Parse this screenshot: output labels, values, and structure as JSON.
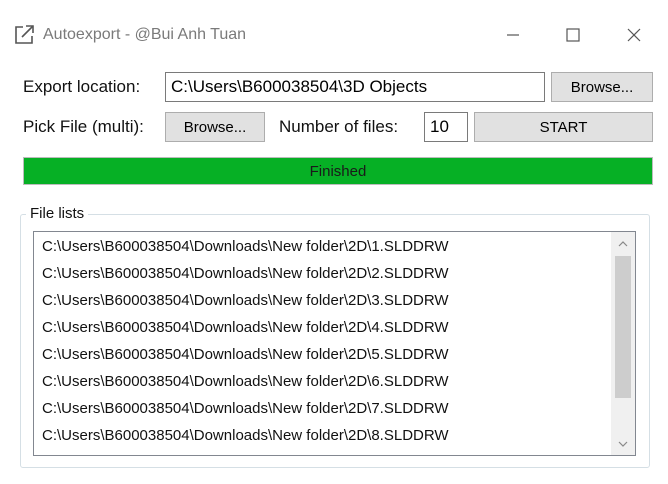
{
  "window": {
    "title": "Autoexport - @Bui Anh Tuan",
    "icons": [
      "export-icon",
      "minimize-icon",
      "maximize-icon",
      "close-icon"
    ]
  },
  "export": {
    "label": "Export location:",
    "path": "C:\\Users\\B600038504\\3D Objects",
    "browse_label": "Browse..."
  },
  "pick": {
    "label": "Pick File (multi):",
    "browse_label": "Browse...",
    "count_label": "Number of files:",
    "count_value": "10",
    "start_label": "START"
  },
  "progress": {
    "text": "Finished",
    "value": 1.0,
    "color": "#06b025"
  },
  "file_list": {
    "title": "File lists",
    "items": [
      "C:\\Users\\B600038504\\Downloads\\New folder\\2D\\1.SLDDRW",
      "C:\\Users\\B600038504\\Downloads\\New folder\\2D\\2.SLDDRW",
      "C:\\Users\\B600038504\\Downloads\\New folder\\2D\\3.SLDDRW",
      "C:\\Users\\B600038504\\Downloads\\New folder\\2D\\4.SLDDRW",
      "C:\\Users\\B600038504\\Downloads\\New folder\\2D\\5.SLDDRW",
      "C:\\Users\\B600038504\\Downloads\\New folder\\2D\\6.SLDDRW",
      "C:\\Users\\B600038504\\Downloads\\New folder\\2D\\7.SLDDRW",
      "C:\\Users\\B600038504\\Downloads\\New folder\\2D\\8.SLDDRW"
    ],
    "scroll_icons": [
      "chevron-up-icon",
      "chevron-down-icon"
    ]
  }
}
